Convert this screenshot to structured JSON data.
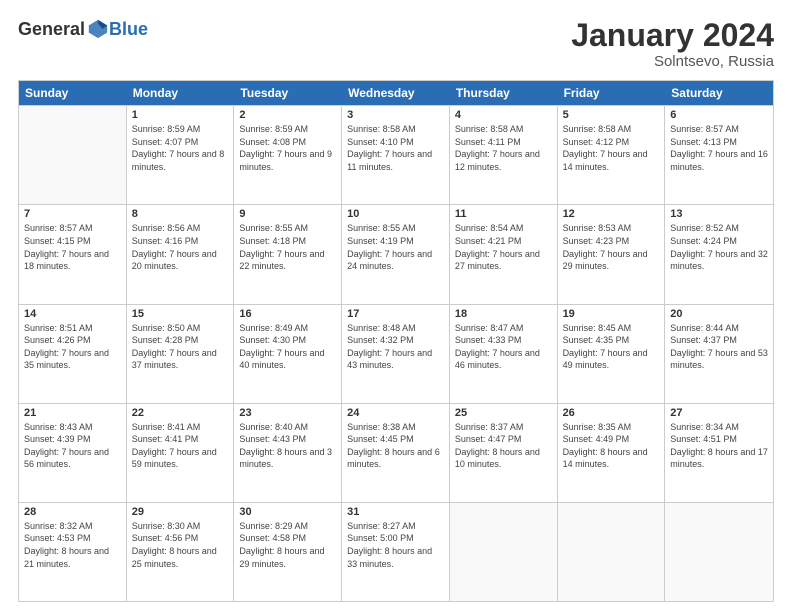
{
  "header": {
    "logo_general": "General",
    "logo_blue": "Blue",
    "month_title": "January 2024",
    "location": "Solntsevo, Russia"
  },
  "days_of_week": [
    "Sunday",
    "Monday",
    "Tuesday",
    "Wednesday",
    "Thursday",
    "Friday",
    "Saturday"
  ],
  "weeks": [
    [
      {
        "day": "",
        "sunrise": "",
        "sunset": "",
        "daylight": "",
        "empty": true
      },
      {
        "day": "1",
        "sunrise": "Sunrise: 8:59 AM",
        "sunset": "Sunset: 4:07 PM",
        "daylight": "Daylight: 7 hours and 8 minutes.",
        "empty": false
      },
      {
        "day": "2",
        "sunrise": "Sunrise: 8:59 AM",
        "sunset": "Sunset: 4:08 PM",
        "daylight": "Daylight: 7 hours and 9 minutes.",
        "empty": false
      },
      {
        "day": "3",
        "sunrise": "Sunrise: 8:58 AM",
        "sunset": "Sunset: 4:10 PM",
        "daylight": "Daylight: 7 hours and 11 minutes.",
        "empty": false
      },
      {
        "day": "4",
        "sunrise": "Sunrise: 8:58 AM",
        "sunset": "Sunset: 4:11 PM",
        "daylight": "Daylight: 7 hours and 12 minutes.",
        "empty": false
      },
      {
        "day": "5",
        "sunrise": "Sunrise: 8:58 AM",
        "sunset": "Sunset: 4:12 PM",
        "daylight": "Daylight: 7 hours and 14 minutes.",
        "empty": false
      },
      {
        "day": "6",
        "sunrise": "Sunrise: 8:57 AM",
        "sunset": "Sunset: 4:13 PM",
        "daylight": "Daylight: 7 hours and 16 minutes.",
        "empty": false
      }
    ],
    [
      {
        "day": "7",
        "sunrise": "Sunrise: 8:57 AM",
        "sunset": "Sunset: 4:15 PM",
        "daylight": "Daylight: 7 hours and 18 minutes.",
        "empty": false
      },
      {
        "day": "8",
        "sunrise": "Sunrise: 8:56 AM",
        "sunset": "Sunset: 4:16 PM",
        "daylight": "Daylight: 7 hours and 20 minutes.",
        "empty": false
      },
      {
        "day": "9",
        "sunrise": "Sunrise: 8:55 AM",
        "sunset": "Sunset: 4:18 PM",
        "daylight": "Daylight: 7 hours and 22 minutes.",
        "empty": false
      },
      {
        "day": "10",
        "sunrise": "Sunrise: 8:55 AM",
        "sunset": "Sunset: 4:19 PM",
        "daylight": "Daylight: 7 hours and 24 minutes.",
        "empty": false
      },
      {
        "day": "11",
        "sunrise": "Sunrise: 8:54 AM",
        "sunset": "Sunset: 4:21 PM",
        "daylight": "Daylight: 7 hours and 27 minutes.",
        "empty": false
      },
      {
        "day": "12",
        "sunrise": "Sunrise: 8:53 AM",
        "sunset": "Sunset: 4:23 PM",
        "daylight": "Daylight: 7 hours and 29 minutes.",
        "empty": false
      },
      {
        "day": "13",
        "sunrise": "Sunrise: 8:52 AM",
        "sunset": "Sunset: 4:24 PM",
        "daylight": "Daylight: 7 hours and 32 minutes.",
        "empty": false
      }
    ],
    [
      {
        "day": "14",
        "sunrise": "Sunrise: 8:51 AM",
        "sunset": "Sunset: 4:26 PM",
        "daylight": "Daylight: 7 hours and 35 minutes.",
        "empty": false
      },
      {
        "day": "15",
        "sunrise": "Sunrise: 8:50 AM",
        "sunset": "Sunset: 4:28 PM",
        "daylight": "Daylight: 7 hours and 37 minutes.",
        "empty": false
      },
      {
        "day": "16",
        "sunrise": "Sunrise: 8:49 AM",
        "sunset": "Sunset: 4:30 PM",
        "daylight": "Daylight: 7 hours and 40 minutes.",
        "empty": false
      },
      {
        "day": "17",
        "sunrise": "Sunrise: 8:48 AM",
        "sunset": "Sunset: 4:32 PM",
        "daylight": "Daylight: 7 hours and 43 minutes.",
        "empty": false
      },
      {
        "day": "18",
        "sunrise": "Sunrise: 8:47 AM",
        "sunset": "Sunset: 4:33 PM",
        "daylight": "Daylight: 7 hours and 46 minutes.",
        "empty": false
      },
      {
        "day": "19",
        "sunrise": "Sunrise: 8:45 AM",
        "sunset": "Sunset: 4:35 PM",
        "daylight": "Daylight: 7 hours and 49 minutes.",
        "empty": false
      },
      {
        "day": "20",
        "sunrise": "Sunrise: 8:44 AM",
        "sunset": "Sunset: 4:37 PM",
        "daylight": "Daylight: 7 hours and 53 minutes.",
        "empty": false
      }
    ],
    [
      {
        "day": "21",
        "sunrise": "Sunrise: 8:43 AM",
        "sunset": "Sunset: 4:39 PM",
        "daylight": "Daylight: 7 hours and 56 minutes.",
        "empty": false
      },
      {
        "day": "22",
        "sunrise": "Sunrise: 8:41 AM",
        "sunset": "Sunset: 4:41 PM",
        "daylight": "Daylight: 7 hours and 59 minutes.",
        "empty": false
      },
      {
        "day": "23",
        "sunrise": "Sunrise: 8:40 AM",
        "sunset": "Sunset: 4:43 PM",
        "daylight": "Daylight: 8 hours and 3 minutes.",
        "empty": false
      },
      {
        "day": "24",
        "sunrise": "Sunrise: 8:38 AM",
        "sunset": "Sunset: 4:45 PM",
        "daylight": "Daylight: 8 hours and 6 minutes.",
        "empty": false
      },
      {
        "day": "25",
        "sunrise": "Sunrise: 8:37 AM",
        "sunset": "Sunset: 4:47 PM",
        "daylight": "Daylight: 8 hours and 10 minutes.",
        "empty": false
      },
      {
        "day": "26",
        "sunrise": "Sunrise: 8:35 AM",
        "sunset": "Sunset: 4:49 PM",
        "daylight": "Daylight: 8 hours and 14 minutes.",
        "empty": false
      },
      {
        "day": "27",
        "sunrise": "Sunrise: 8:34 AM",
        "sunset": "Sunset: 4:51 PM",
        "daylight": "Daylight: 8 hours and 17 minutes.",
        "empty": false
      }
    ],
    [
      {
        "day": "28",
        "sunrise": "Sunrise: 8:32 AM",
        "sunset": "Sunset: 4:53 PM",
        "daylight": "Daylight: 8 hours and 21 minutes.",
        "empty": false
      },
      {
        "day": "29",
        "sunrise": "Sunrise: 8:30 AM",
        "sunset": "Sunset: 4:56 PM",
        "daylight": "Daylight: 8 hours and 25 minutes.",
        "empty": false
      },
      {
        "day": "30",
        "sunrise": "Sunrise: 8:29 AM",
        "sunset": "Sunset: 4:58 PM",
        "daylight": "Daylight: 8 hours and 29 minutes.",
        "empty": false
      },
      {
        "day": "31",
        "sunrise": "Sunrise: 8:27 AM",
        "sunset": "Sunset: 5:00 PM",
        "daylight": "Daylight: 8 hours and 33 minutes.",
        "empty": false
      },
      {
        "day": "",
        "sunrise": "",
        "sunset": "",
        "daylight": "",
        "empty": true
      },
      {
        "day": "",
        "sunrise": "",
        "sunset": "",
        "daylight": "",
        "empty": true
      },
      {
        "day": "",
        "sunrise": "",
        "sunset": "",
        "daylight": "",
        "empty": true
      }
    ]
  ]
}
